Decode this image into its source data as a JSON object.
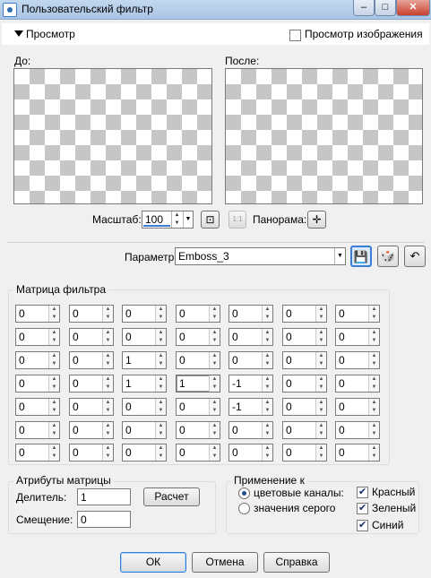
{
  "window": {
    "title": "Пользовательский фильтр",
    "min_glyph": "–",
    "max_glyph": "□",
    "close_glyph": "✕"
  },
  "preview": {
    "section_label": "Просмотр",
    "show_image_label": "Просмотр изображения",
    "show_image_checked": false,
    "before_label": "До:",
    "after_label": "После:"
  },
  "zoom": {
    "label": "Масштаб:",
    "value": "100",
    "pan_label": "Панорама:",
    "fit_glyph": "⊡",
    "actual_glyph": "1:1",
    "pan_glyph": "✛"
  },
  "params": {
    "label": "Параметры",
    "preset": "Emboss_3",
    "save_glyph": "💾",
    "random_glyph": "🎲",
    "reset_glyph": "↶"
  },
  "matrix": {
    "title": "Матрица фильтра",
    "rows": [
      [
        "0",
        "0",
        "0",
        "0",
        "0",
        "0",
        "0"
      ],
      [
        "0",
        "0",
        "0",
        "0",
        "0",
        "0",
        "0"
      ],
      [
        "0",
        "0",
        "1",
        "0",
        "0",
        "0",
        "0"
      ],
      [
        "0",
        "0",
        "1",
        "1",
        "-1",
        "0",
        "0"
      ],
      [
        "0",
        "0",
        "0",
        "0",
        "-1",
        "0",
        "0"
      ],
      [
        "0",
        "0",
        "0",
        "0",
        "0",
        "0",
        "0"
      ],
      [
        "0",
        "0",
        "0",
        "0",
        "0",
        "0",
        "0"
      ]
    ]
  },
  "attributes": {
    "title": "Атрибуты матрицы",
    "divisor_label": "Делитель:",
    "divisor_value": "1",
    "offset_label": "Смещение:",
    "offset_value": "0",
    "calc_label": "Расчет"
  },
  "apply": {
    "title": "Применение к",
    "color_channels_label": "цветовые каналы:",
    "color_channels_selected": true,
    "gray_values_label": "значения серого",
    "red_label": "Красный",
    "red_checked": true,
    "green_label": "Зеленый",
    "green_checked": true,
    "blue_label": "Синий",
    "blue_checked": true
  },
  "buttons": {
    "ok": "ОК",
    "cancel": "Отмена",
    "help": "Справка"
  },
  "colors": {
    "accent": "#3b7ed6",
    "title_bar": "#bcd3ec",
    "close": "#c8402f"
  }
}
